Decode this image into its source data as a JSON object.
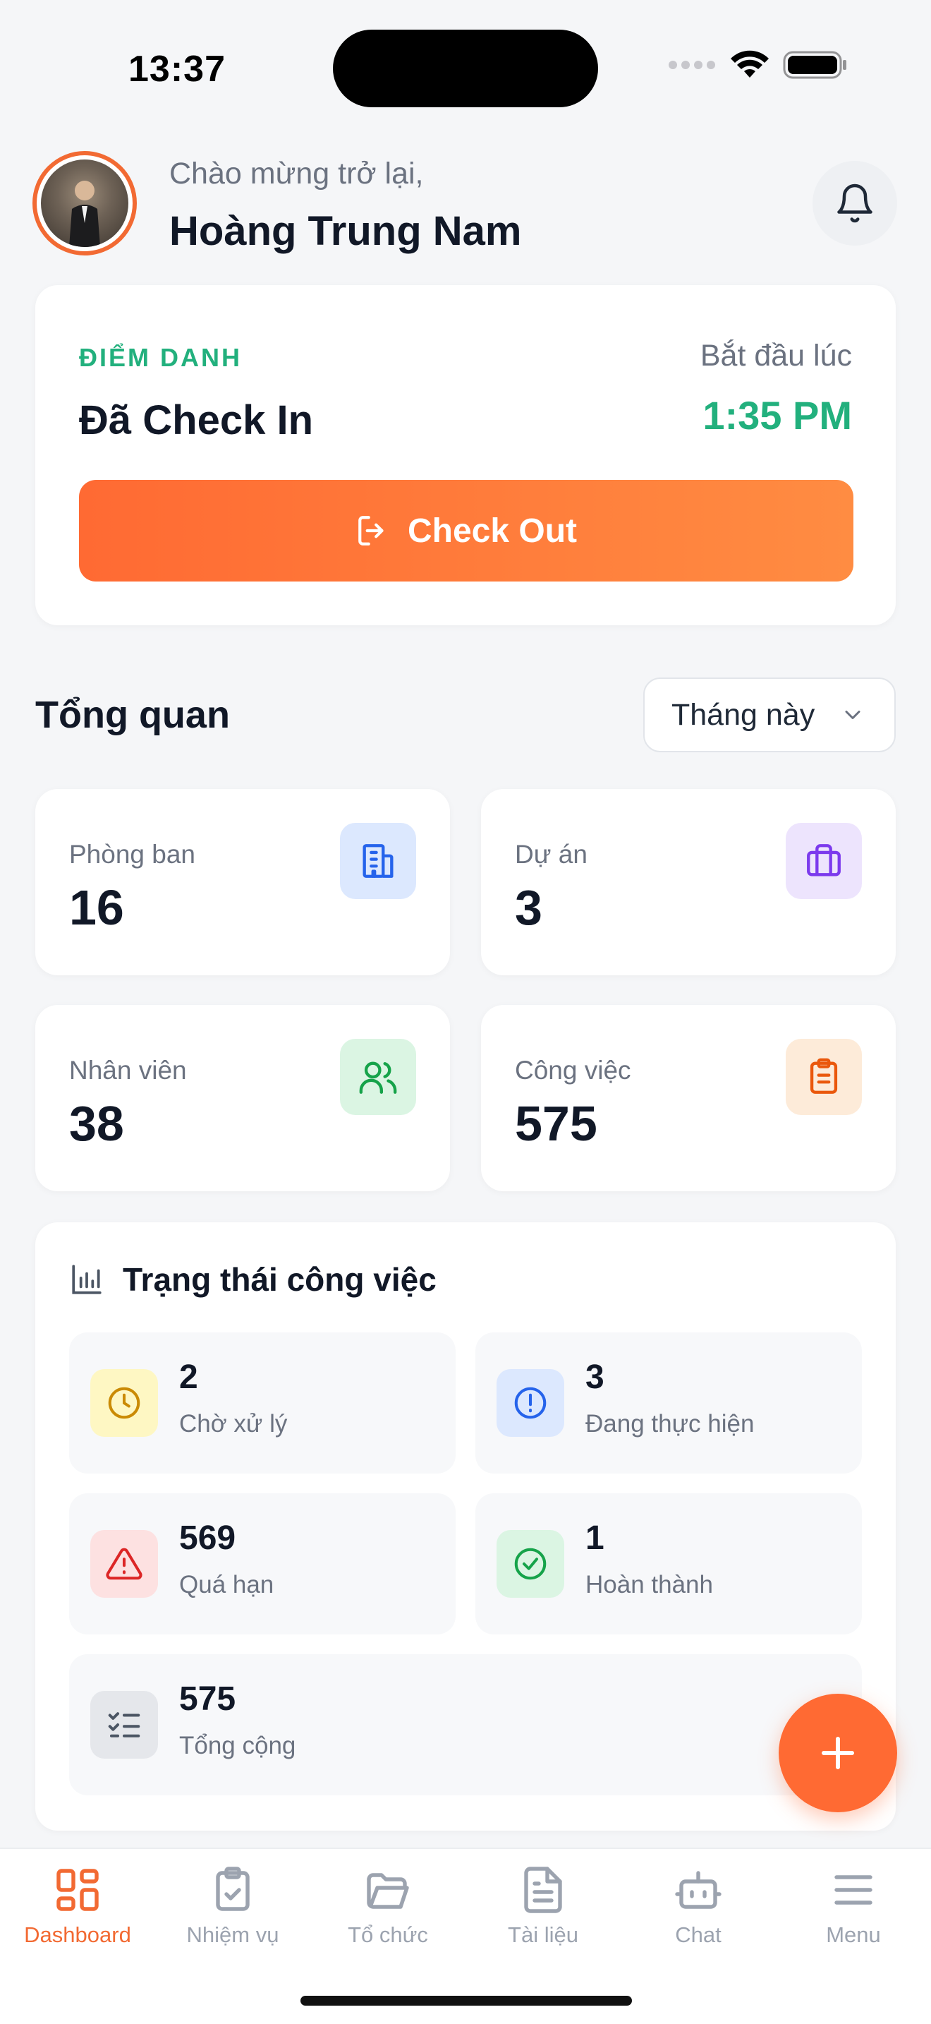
{
  "status_bar": {
    "time": "13:37"
  },
  "header": {
    "greeting": "Chào mừng trở lại,",
    "user_name": "Hoàng Trung Nam"
  },
  "attendance": {
    "label": "ĐIỂM DANH",
    "status": "Đã Check In",
    "start_label": "Bắt đầu lúc",
    "start_time": "1:35 PM",
    "button_label": "Check Out"
  },
  "overview": {
    "title": "Tổng quan",
    "period": "Tháng này",
    "stats": [
      {
        "label": "Phòng ban",
        "value": "16",
        "icon": "building-icon"
      },
      {
        "label": "Dự án",
        "value": "3",
        "icon": "briefcase-icon"
      },
      {
        "label": "Nhân viên",
        "value": "38",
        "icon": "users-icon"
      },
      {
        "label": "Công việc",
        "value": "575",
        "icon": "clipboard-list-icon"
      }
    ]
  },
  "task_status": {
    "title": "Trạng thái công việc",
    "items": [
      {
        "value": "2",
        "label": "Chờ xử lý",
        "icon": "clock-icon",
        "color": "#CA8A04"
      },
      {
        "value": "3",
        "label": "Đang thực hiện",
        "icon": "alert-circle-icon",
        "color": "#2563EB"
      },
      {
        "value": "569",
        "label": "Quá hạn",
        "icon": "alert-triangle-icon",
        "color": "#DC2626"
      },
      {
        "value": "1",
        "label": "Hoàn thành",
        "icon": "check-circle-icon",
        "color": "#16A34A"
      },
      {
        "value": "575",
        "label": "Tổng cộng",
        "icon": "list-checks-icon",
        "color": "#4B5563"
      }
    ]
  },
  "tabbar": {
    "items": [
      {
        "label": "Dashboard",
        "icon": "dashboard-grid-icon",
        "active": true
      },
      {
        "label": "Nhiệm vụ",
        "icon": "clipboard-check-icon",
        "active": false
      },
      {
        "label": "Tổ chức",
        "icon": "folder-open-icon",
        "active": false
      },
      {
        "label": "Tài liệu",
        "icon": "document-icon",
        "active": false
      },
      {
        "label": "Chat",
        "icon": "bot-icon",
        "active": false
      },
      {
        "label": "Menu",
        "icon": "menu-icon",
        "active": false
      }
    ]
  },
  "colors": {
    "accent": "#FF6A33",
    "success": "#22B07D",
    "background": "#F5F6F8"
  }
}
